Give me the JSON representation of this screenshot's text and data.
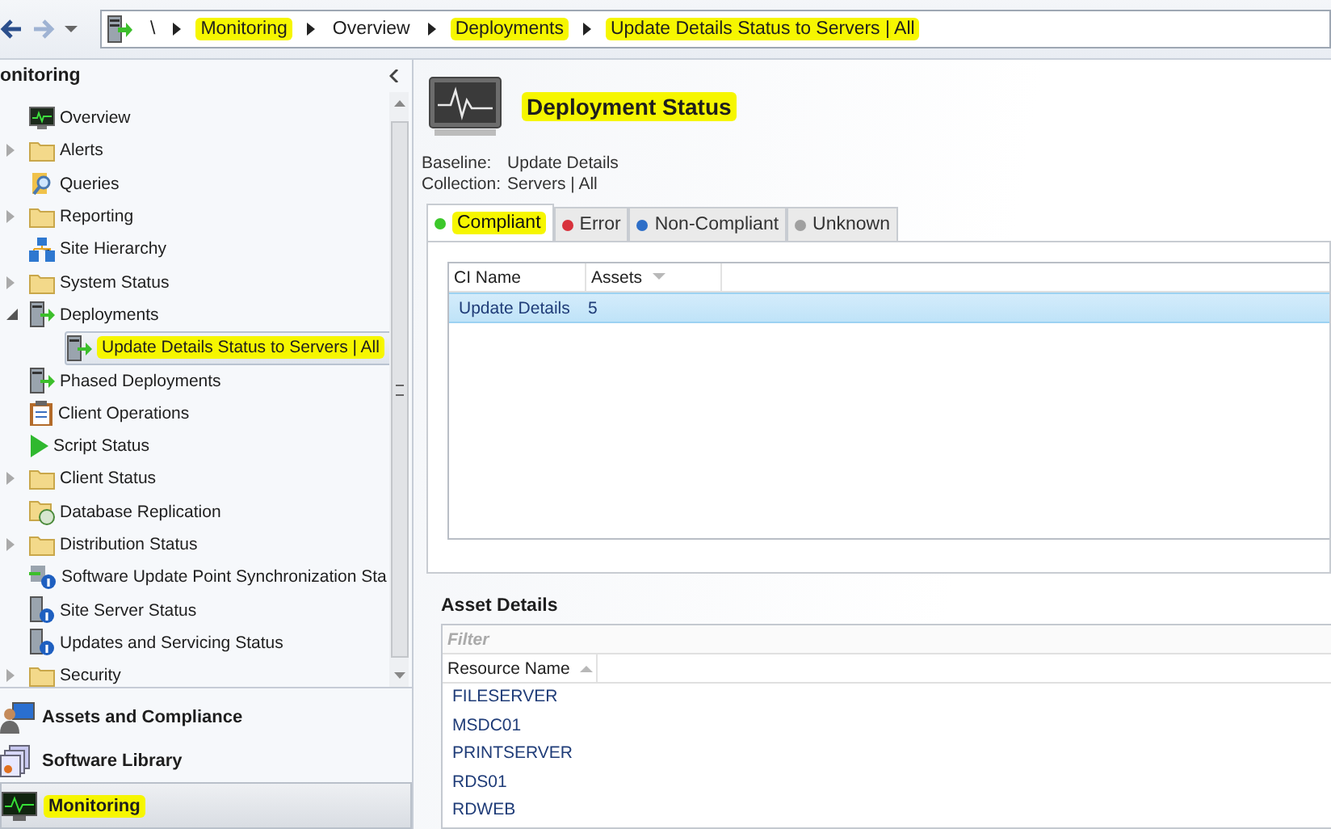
{
  "toolbar": {
    "path_root": "\\",
    "breadcrumbs": [
      {
        "label": "Monitoring",
        "highlighted": true
      },
      {
        "label": "Overview",
        "highlighted": false
      },
      {
        "label": "Deployments",
        "highlighted": true
      },
      {
        "label": "Update Details Status to Servers | All",
        "highlighted": true
      }
    ]
  },
  "sidebar": {
    "title": "onitoring",
    "tree": [
      {
        "label": "Overview",
        "kind": "monitor",
        "selected": false,
        "highlighted": false
      },
      {
        "label": "Alerts",
        "kind": "folder",
        "expanded": false,
        "selected": false,
        "highlighted": false
      },
      {
        "label": "Queries",
        "kind": "query",
        "selected": false,
        "highlighted": false
      },
      {
        "label": "Reporting",
        "kind": "folder",
        "expanded": false,
        "selected": false,
        "highlighted": false
      },
      {
        "label": "Site Hierarchy",
        "kind": "hierarchy",
        "selected": false,
        "highlighted": false
      },
      {
        "label": "System Status",
        "kind": "folder",
        "expanded": false,
        "selected": false,
        "highlighted": false
      },
      {
        "label": "Deployments",
        "kind": "deploy",
        "expanded": true,
        "selected": false,
        "highlighted": false,
        "children": [
          {
            "label": "Update Details Status to Servers | All",
            "kind": "deploy",
            "selected": true,
            "highlighted": true
          }
        ]
      },
      {
        "label": "Phased Deployments",
        "kind": "deploy",
        "selected": false,
        "highlighted": false
      },
      {
        "label": "Client Operations",
        "kind": "clipboard",
        "selected": false,
        "highlighted": false
      },
      {
        "label": "Script Status",
        "kind": "play",
        "selected": false,
        "highlighted": false
      },
      {
        "label": "Client Status",
        "kind": "folder",
        "expanded": false,
        "selected": false,
        "highlighted": false
      },
      {
        "label": "Database Replication",
        "kind": "database",
        "selected": false,
        "highlighted": false
      },
      {
        "label": "Distribution Status",
        "kind": "folder",
        "expanded": false,
        "selected": false,
        "highlighted": false
      },
      {
        "label": "Software Update Point Synchronization Sta",
        "kind": "sync",
        "selected": false,
        "highlighted": false
      },
      {
        "label": "Site Server Status",
        "kind": "server",
        "selected": false,
        "highlighted": false
      },
      {
        "label": "Updates and Servicing Status",
        "kind": "server",
        "selected": false,
        "highlighted": false
      },
      {
        "label": "Security",
        "kind": "folder",
        "expanded": false,
        "selected": false,
        "highlighted": false
      }
    ],
    "workspaces": [
      {
        "label": "Assets and Compliance",
        "kind": "person",
        "selected": false,
        "highlighted": false
      },
      {
        "label": "Software Library",
        "kind": "library",
        "selected": false,
        "highlighted": false
      },
      {
        "label": "Monitoring",
        "kind": "monitor",
        "selected": true,
        "highlighted": true
      }
    ]
  },
  "main": {
    "title": "Deployment Status",
    "title_highlighted": true,
    "details": [
      {
        "label": "Baseline:",
        "value": "Update Details"
      },
      {
        "label": "Collection:",
        "value": "Servers | All"
      }
    ],
    "tabs": [
      {
        "label": "Compliant",
        "color": "#3cc82a",
        "selected": true,
        "highlighted": true
      },
      {
        "label": "Error",
        "color": "#d8323c",
        "selected": false,
        "highlighted": false
      },
      {
        "label": "Non-Compliant",
        "color": "#2e6fc8",
        "selected": false,
        "highlighted": false
      },
      {
        "label": "Unknown",
        "color": "#a0a0a0",
        "selected": false,
        "highlighted": false
      }
    ],
    "ci_table": {
      "columns": [
        {
          "label": "CI Name",
          "kind": "plain"
        },
        {
          "label": "Assets",
          "kind": "sorted-desc"
        }
      ],
      "rows": [
        {
          "cells": [
            "Update Details",
            "5"
          ],
          "selected": true
        }
      ]
    },
    "asset_details": {
      "title": "Asset Details",
      "filter": {
        "placeholder": "Filter"
      },
      "columns": [
        {
          "label": "Resource Name",
          "kind": "sorted-asc"
        }
      ],
      "rows": [
        "FILESERVER",
        "MSDC01",
        "PRINTSERVER",
        "RDS01",
        "RDWEB"
      ]
    }
  }
}
